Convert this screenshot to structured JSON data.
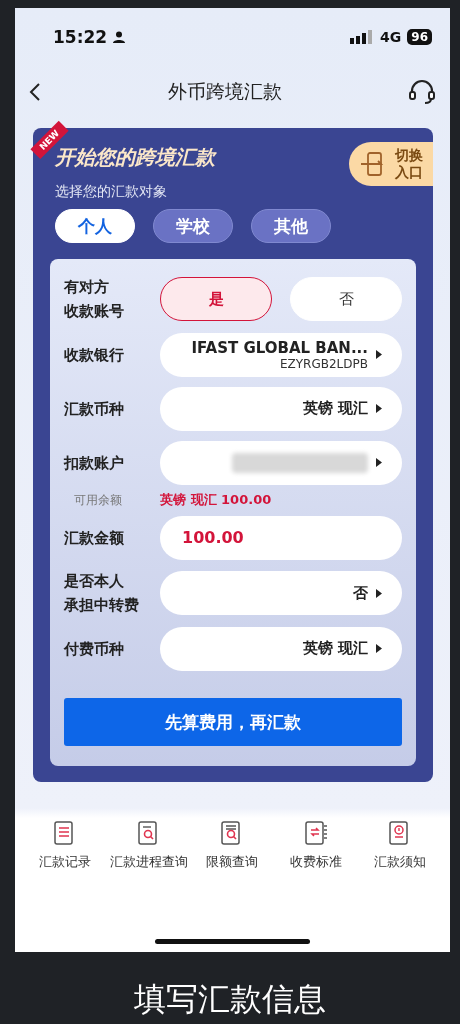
{
  "status_bar": {
    "time": "15:22",
    "network": "4G",
    "battery": "96"
  },
  "nav": {
    "title": "外币跨境汇款"
  },
  "card": {
    "badge": "NEW",
    "title": "开始您的跨境汇款",
    "subtitle": "选择您的汇款对象",
    "switch_label": [
      "切换",
      "入口"
    ],
    "tabs": [
      {
        "label": "个人",
        "selected": true
      },
      {
        "label": "学校",
        "selected": false
      },
      {
        "label": "其他",
        "selected": false
      }
    ]
  },
  "form": {
    "rows": [
      {
        "kind": "toggle",
        "label": [
          "有对方",
          "收款账号"
        ],
        "options": [
          {
            "label": "是",
            "selected": true
          },
          {
            "label": "否",
            "selected": false
          }
        ]
      },
      {
        "kind": "select",
        "label": "收款银行",
        "value": "IFAST GLOBAL BAN...",
        "subvalue": "EZYRGB2LDPB"
      },
      {
        "kind": "select",
        "label": "汇款币种",
        "value": "英镑 现汇"
      },
      {
        "kind": "masked",
        "label": "扣款账户"
      },
      {
        "kind": "note",
        "label": "可用余额",
        "value": "英镑 现汇 100.00"
      },
      {
        "kind": "input",
        "label": "汇款金额",
        "value": "100.00"
      },
      {
        "kind": "select",
        "label": [
          "是否本人",
          "承担中转费"
        ],
        "value": "否"
      },
      {
        "kind": "select",
        "label": "付费币种",
        "value": "英镑 现汇"
      }
    ],
    "submit": "先算费用，再汇款"
  },
  "quick_links": [
    {
      "label": "汇款记录",
      "kind": "list"
    },
    {
      "label": "汇款进程查询",
      "kind": "search"
    },
    {
      "label": "限额查询",
      "kind": "limit"
    },
    {
      "label": "收费标准",
      "kind": "fee"
    },
    {
      "label": "汇款须知",
      "kind": "notice"
    }
  ],
  "caption": "填写汇款信息"
}
